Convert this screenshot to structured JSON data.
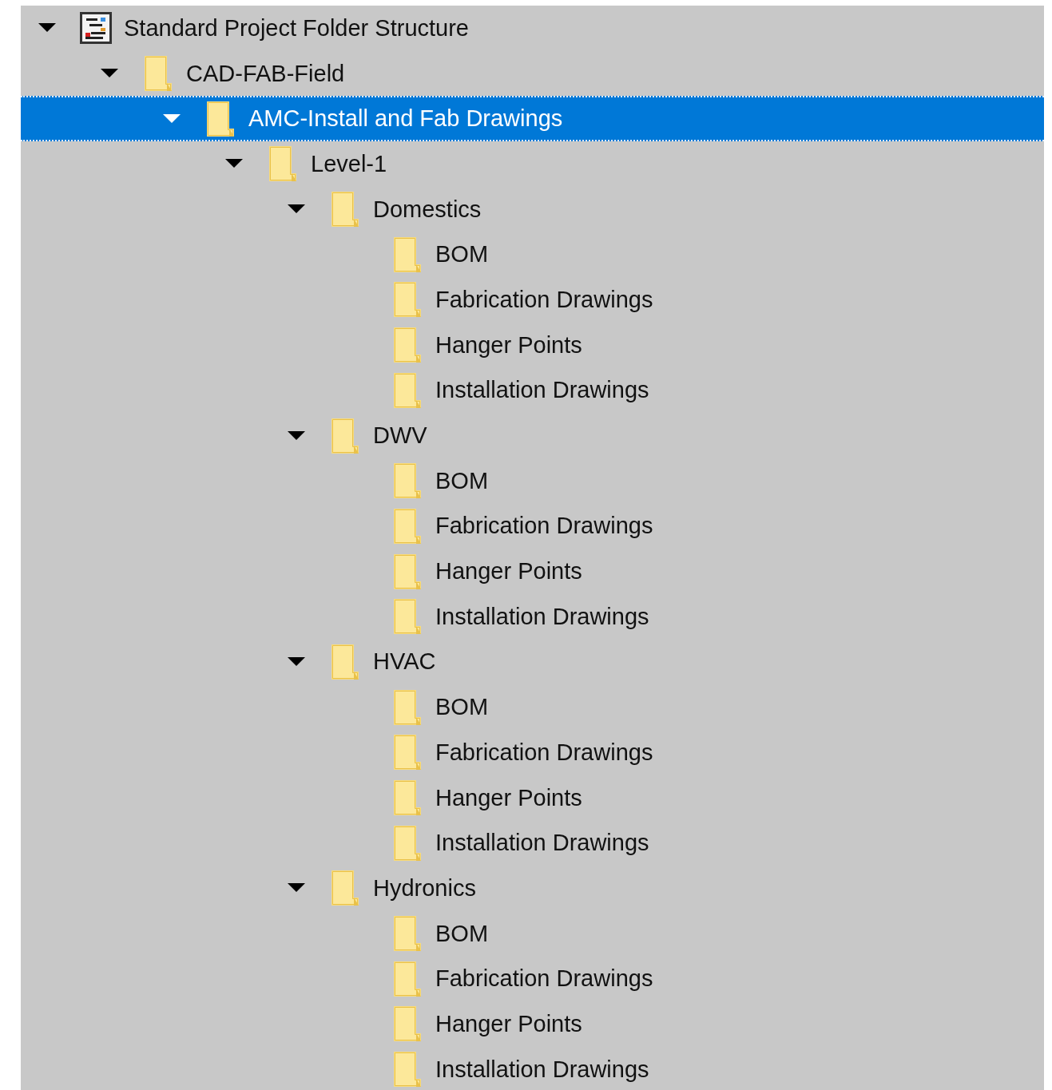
{
  "tree": [
    {
      "label": "Standard Project Folder Structure",
      "kind": "project",
      "expanded": true,
      "selected": false,
      "children": [
        {
          "label": "CAD-FAB-Field",
          "kind": "folder",
          "expanded": true,
          "selected": false,
          "children": [
            {
              "label": "AMC-Install and Fab Drawings",
              "kind": "folder",
              "expanded": true,
              "selected": true,
              "children": [
                {
                  "label": "Level-1",
                  "kind": "folder",
                  "expanded": true,
                  "selected": false,
                  "children": [
                    {
                      "label": "Domestics",
                      "kind": "folder",
                      "expanded": true,
                      "selected": false,
                      "children": [
                        {
                          "label": "BOM",
                          "kind": "folder",
                          "selected": false
                        },
                        {
                          "label": "Fabrication Drawings",
                          "kind": "folder",
                          "selected": false
                        },
                        {
                          "label": "Hanger Points",
                          "kind": "folder",
                          "selected": false
                        },
                        {
                          "label": "Installation Drawings",
                          "kind": "folder",
                          "selected": false
                        }
                      ]
                    },
                    {
                      "label": "DWV",
                      "kind": "folder",
                      "expanded": true,
                      "selected": false,
                      "children": [
                        {
                          "label": "BOM",
                          "kind": "folder",
                          "selected": false
                        },
                        {
                          "label": "Fabrication Drawings",
                          "kind": "folder",
                          "selected": false
                        },
                        {
                          "label": "Hanger Points",
                          "kind": "folder",
                          "selected": false
                        },
                        {
                          "label": "Installation Drawings",
                          "kind": "folder",
                          "selected": false
                        }
                      ]
                    },
                    {
                      "label": "HVAC",
                      "kind": "folder",
                      "expanded": true,
                      "selected": false,
                      "children": [
                        {
                          "label": "BOM",
                          "kind": "folder",
                          "selected": false
                        },
                        {
                          "label": "Fabrication Drawings",
                          "kind": "folder",
                          "selected": false
                        },
                        {
                          "label": "Hanger Points",
                          "kind": "folder",
                          "selected": false
                        },
                        {
                          "label": "Installation Drawings",
                          "kind": "folder",
                          "selected": false
                        }
                      ]
                    },
                    {
                      "label": "Hydronics",
                      "kind": "folder",
                      "expanded": true,
                      "selected": false,
                      "children": [
                        {
                          "label": "BOM",
                          "kind": "folder",
                          "selected": false
                        },
                        {
                          "label": "Fabrication Drawings",
                          "kind": "folder",
                          "selected": false
                        },
                        {
                          "label": "Hanger Points",
                          "kind": "folder",
                          "selected": false
                        },
                        {
                          "label": "Installation Drawings",
                          "kind": "folder",
                          "selected": false
                        }
                      ]
                    }
                  ]
                }
              ]
            }
          ]
        }
      ]
    }
  ]
}
